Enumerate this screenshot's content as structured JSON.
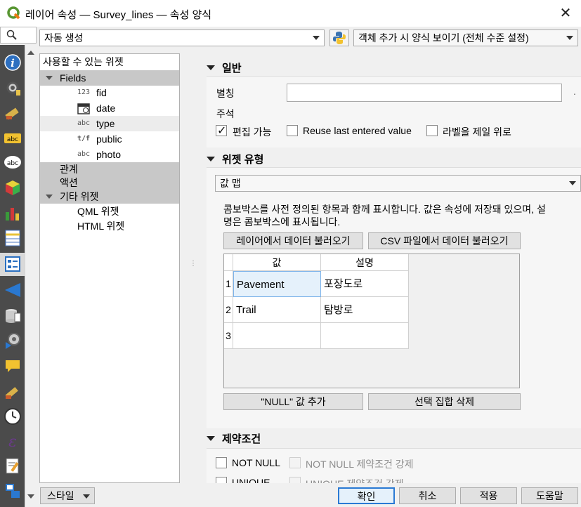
{
  "window": {
    "title": "레이어 속성 — Survey_lines — 속성 양식"
  },
  "toolbar": {
    "mode_combo": "자동 생성",
    "form_visibility_combo": "객체 추가 시 양식 보이기 (전체 수준 설정)"
  },
  "sidebar": {
    "icons": [
      "information-icon",
      "source-icon",
      "symbology-icon",
      "labels-icon",
      "masks-icon",
      "3d-view-icon",
      "diagrams-icon",
      "fields-icon",
      "attributes-form-icon",
      "joins-icon",
      "auxiliary-storage-icon",
      "actions-icon",
      "display-icon",
      "rendering-icon",
      "temporal-icon",
      "variables-icon",
      "metadata-icon",
      "dependencies-icon"
    ]
  },
  "tree": {
    "header": "사용할 수 있는 위젯",
    "fields_label": "Fields",
    "items": [
      {
        "type_label": "123",
        "name": "fid"
      },
      {
        "type_label": "",
        "name": "date"
      },
      {
        "type_label": "abc",
        "name": "type"
      },
      {
        "type_label": "t/f",
        "name": "public"
      },
      {
        "type_label": "abc",
        "name": "photo"
      }
    ],
    "relations_label": "관계",
    "actions_label": "액션",
    "other_widgets_label": "기타 위젯",
    "qml_widget": "QML 위젯",
    "html_widget": "HTML 위젯"
  },
  "general": {
    "title": "일반",
    "alias_label": "별칭",
    "alias_value": "",
    "comment_label": "주석",
    "editable_label": "편집 가능",
    "editable_checked": true,
    "reuse_label": "Reuse last entered value",
    "reuse_checked": false,
    "label_on_top_label": "라벨을 제일 위로",
    "label_on_top_checked": false
  },
  "widget_type": {
    "title": "위젯 유형",
    "selected": "값 맵",
    "description": "콤보박스를 사전 정의된 항목과 함께 표시합니다. 값은 속성에 저장돼 있으며, 설명은 콤보박스에 표시됩니다.",
    "load_layer_button": "레이어에서 데이터 불러오기",
    "load_csv_button": "CSV 파일에서 데이터 불러오기",
    "table": {
      "headers": [
        "값",
        "설명"
      ],
      "rows": [
        {
          "num": "1",
          "value": "Pavement",
          "description": "포장도로"
        },
        {
          "num": "2",
          "value": "Trail",
          "description": "탐방로"
        },
        {
          "num": "3",
          "value": "",
          "description": ""
        }
      ]
    },
    "add_null_button": "\"NULL\" 값 추가",
    "remove_selected_button": "선택 집합 삭제"
  },
  "constraints": {
    "title": "제약조건",
    "not_null_label": "NOT NULL",
    "enforce_not_null_label": "NOT NULL 제약조건 강제",
    "unique_label": "UNIQUE",
    "enforce_unique_label": "UNIQUE 제약조건 강제"
  },
  "footer": {
    "style_button": "스타일",
    "ok_button": "확인",
    "cancel_button": "취소",
    "apply_button": "적용",
    "help_button": "도움말"
  },
  "colors": {
    "sidebar_bg": "#4b4b4b",
    "selection": "#c8c8c8",
    "accent": "#2a7ad4"
  }
}
